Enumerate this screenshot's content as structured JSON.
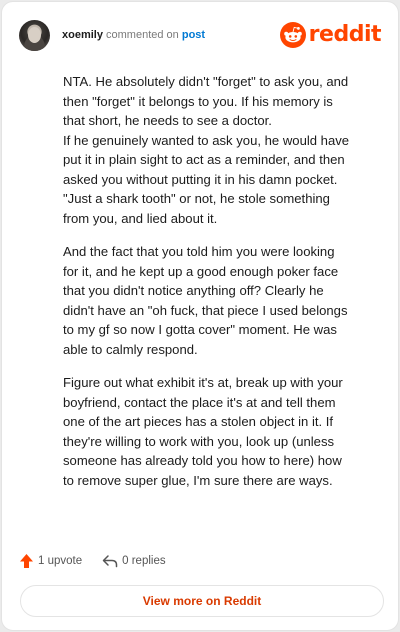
{
  "header": {
    "username": "xoemily",
    "action_text": " commented on ",
    "post_link": "post",
    "logo_text": "reddit",
    "brand_color": "#ff4500"
  },
  "comment": {
    "paragraphs": [
      [
        "NTA. He absolutely didn't \"forget\" to ask you, and",
        "then \"forget\" it belongs to you. If his memory is",
        "that short, he needs to see a doctor.",
        "If he genuinely wanted to ask you, he would have",
        "put it in plain sight to act as a reminder, and then",
        "asked you without putting it in his damn pocket.",
        "\"Just a shark tooth\" or not, he stole something",
        "from you, and lied about it."
      ],
      [
        "And the fact that you told him you were looking",
        "for it, and he kept up a good enough poker face",
        "that you didn't notice anything off? Clearly he",
        "didn't have an \"oh fuck, that piece I used belongs",
        "to my gf so now I gotta cover\" moment. He was",
        "able to calmly respond."
      ],
      [
        "Figure out what exhibit it's at, break up with your",
        "boyfriend, contact the place it's at and tell them",
        "one of the art pieces has a stolen object in it. If",
        "they're willing to work with you, look up (unless",
        "someone has already told you how to here) how",
        "to remove super glue, I'm sure there are ways."
      ]
    ]
  },
  "actions": {
    "upvote_label": "1 upvote",
    "replies_label": "0 replies"
  },
  "footer": {
    "view_more_label": "View more on Reddit"
  }
}
